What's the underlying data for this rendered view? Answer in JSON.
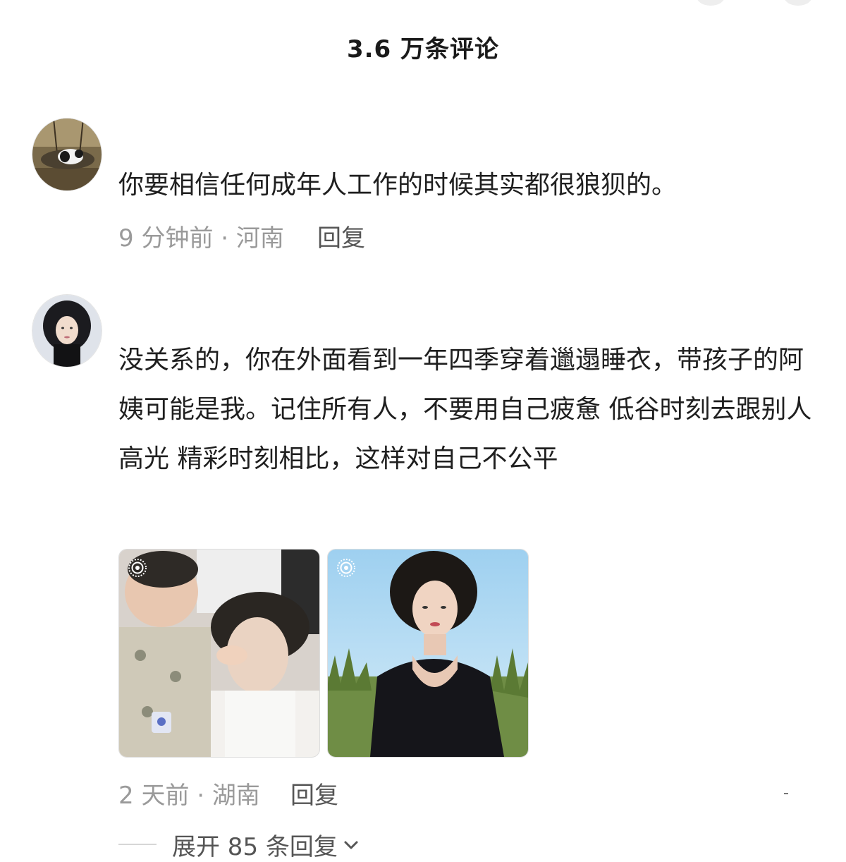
{
  "header": {
    "title": "3.6 万条评论"
  },
  "comments": [
    {
      "text": "你要相信任何成年人工作的时候其实都很狼狈的。",
      "meta": "9 分钟前 · 河南",
      "reply_label": "回复"
    },
    {
      "text": "没关系的，你在外面看到一年四季穿着邋遢睡衣，带孩子的阿姨可能是我。记住所有人，不要用自己疲惫 低谷时刻去跟别人高光 精彩时刻相比，这样对自己不公平",
      "meta": "2 天前 · 湖南",
      "reply_label": "回复",
      "images": [
        "photo-mother-child",
        "photo-woman-field"
      ],
      "expand_label": "展开 85 条回复"
    }
  ],
  "colors": {
    "text": "#1f1f1f",
    "meta": "#9a9a9a",
    "action": "#555555"
  },
  "icons": [
    "live-photo-icon",
    "chevron-down-icon"
  ]
}
